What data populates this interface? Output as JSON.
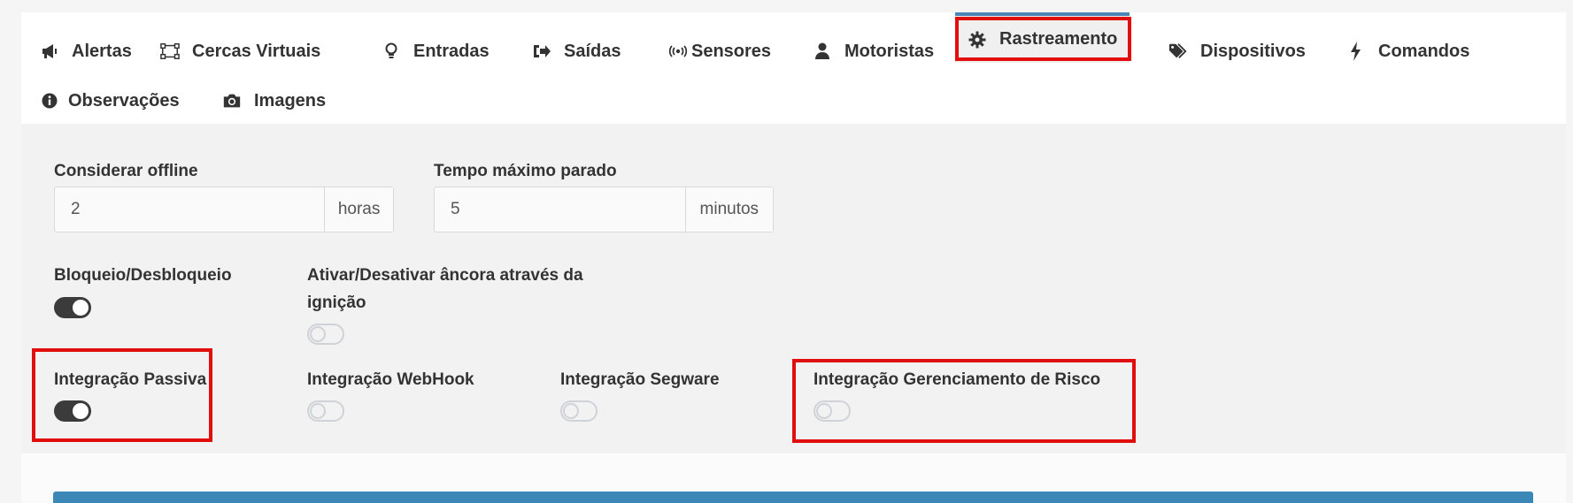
{
  "tabs": [
    {
      "label": "Alertas",
      "icon": "bullhorn-icon"
    },
    {
      "label": "Cercas Virtuais",
      "icon": "vector-square-icon"
    },
    {
      "label": "Entradas",
      "icon": "lightbulb-icon"
    },
    {
      "label": "Saídas",
      "icon": "sign-out-icon"
    },
    {
      "label": "Sensores",
      "icon": "broadcast-icon"
    },
    {
      "label": "Motoristas",
      "icon": "user-icon"
    },
    {
      "label": "Rastreamento",
      "icon": "gear-icon",
      "active": true
    },
    {
      "label": "Dispositivos",
      "icon": "tags-icon"
    },
    {
      "label": "Comandos",
      "icon": "bolt-icon"
    },
    {
      "label": "Observações",
      "icon": "info-circle-icon"
    },
    {
      "label": "Imagens",
      "icon": "camera-icon"
    }
  ],
  "fields": {
    "offline": {
      "label": "Considerar offline",
      "value": "2",
      "unit": "horas"
    },
    "max_stop": {
      "label": "Tempo máximo parado",
      "value": "5",
      "unit": "minutos"
    }
  },
  "toggles": {
    "bloqueio": {
      "label": "Bloqueio/Desbloqueio",
      "on": true
    },
    "ancora": {
      "label_line1": "Ativar/Desativar âncora através da",
      "label_line2": "ignição",
      "on": false
    },
    "passiva": {
      "label": "Integração Passiva",
      "on": true
    },
    "webhook": {
      "label": "Integração WebHook",
      "on": false
    },
    "segware": {
      "label": "Integração Segware",
      "on": false
    },
    "risco": {
      "label": "Integração Gerenciamento de Risco",
      "on": false
    }
  },
  "colors": {
    "accent": "#4a87b8",
    "highlight": "#e20d0d",
    "toggle_on": "#3b3b3c"
  }
}
